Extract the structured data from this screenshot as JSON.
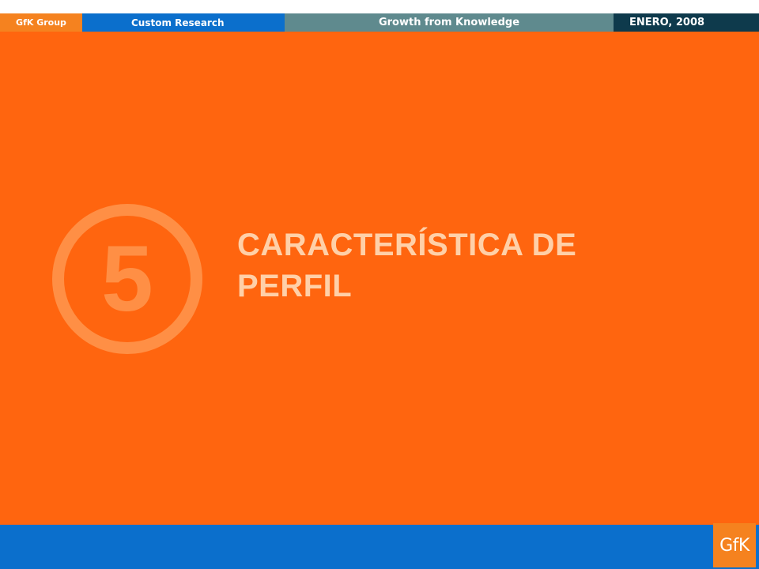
{
  "header": {
    "group_label": "GfK Group",
    "division_label": "Custom Research",
    "tagline": "Growth from Knowledge",
    "date": "ENERO, 2008"
  },
  "section": {
    "number": "5",
    "title_line1": "CARACTERÍSTICA DE",
    "title_line2": "PERFIL"
  },
  "footer": {
    "logo_text": "GfK"
  },
  "colors": {
    "orange_main": "#ff650f",
    "orange_accent": "#f5821f",
    "ring": "#ff8f45",
    "title": "#ffd0a8",
    "blue": "#0b6fcc",
    "teal": "#5f8a8e",
    "navy": "#0e3a4c"
  }
}
